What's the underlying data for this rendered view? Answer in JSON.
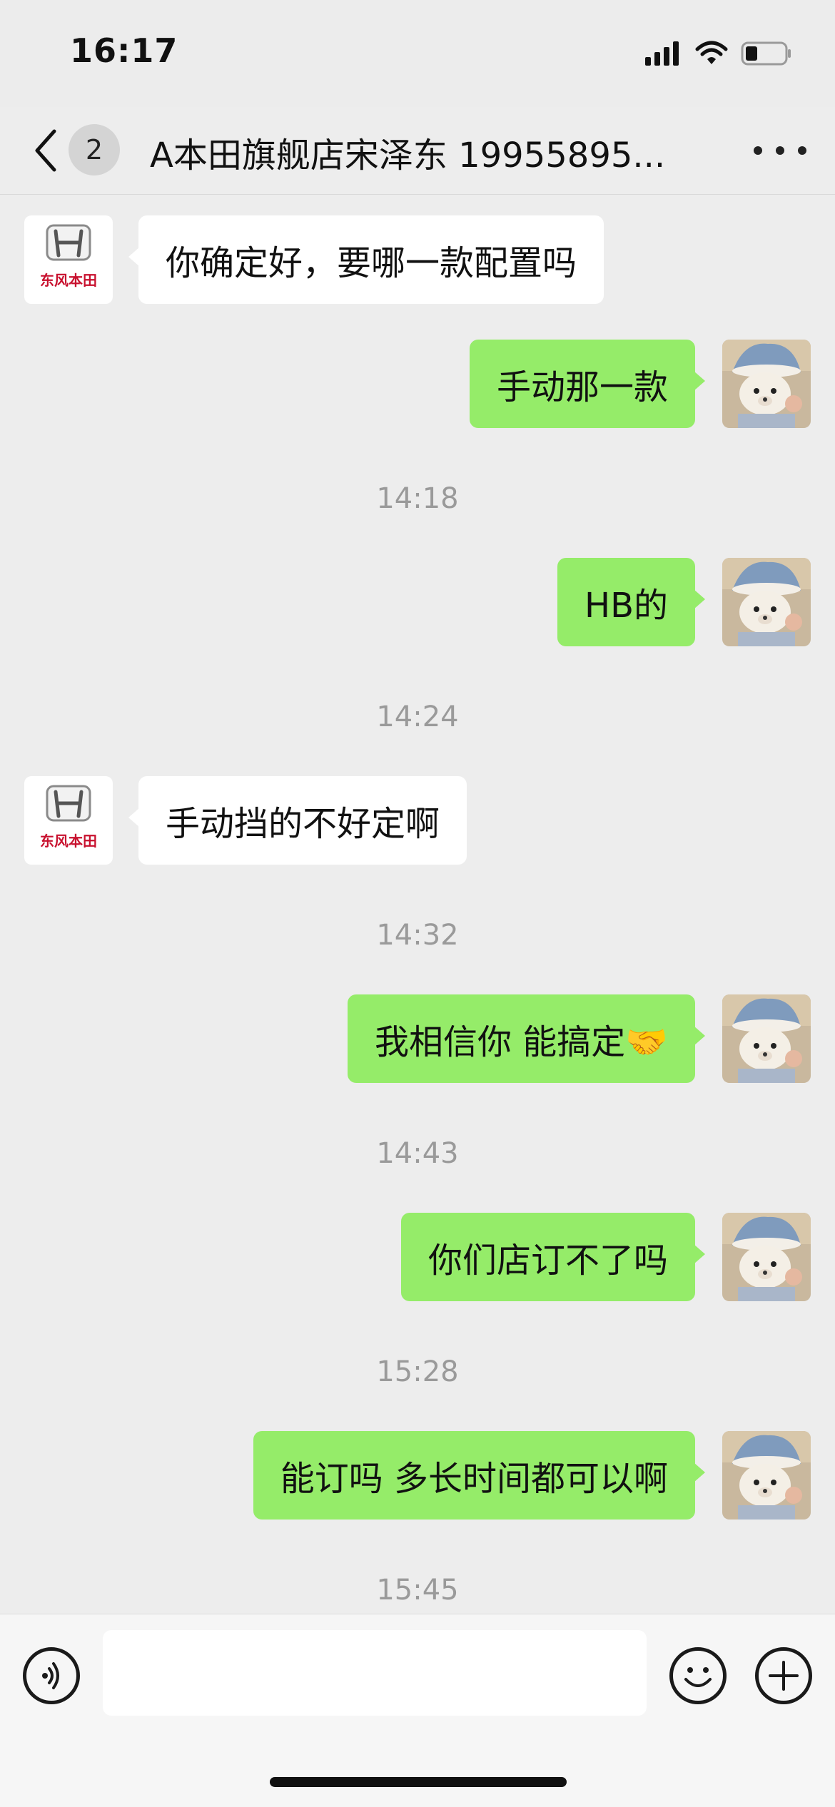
{
  "status_bar": {
    "time": "16:17"
  },
  "header": {
    "unread_count": "2",
    "title": "A本田旗舰店宋泽东 19955895..."
  },
  "contact_avatar": {
    "logo_text": "东风本田"
  },
  "messages": [
    {
      "side": "left",
      "text": "你确定好，要哪一款配置吗"
    },
    {
      "side": "right",
      "text": "手动那一款"
    },
    {
      "type": "time",
      "text": "14:18"
    },
    {
      "side": "right",
      "text": "HB的"
    },
    {
      "type": "time",
      "text": "14:24"
    },
    {
      "side": "left",
      "text": "手动挡的不好定啊"
    },
    {
      "type": "time",
      "text": "14:32"
    },
    {
      "side": "right",
      "text": "我相信你 能搞定🤝"
    },
    {
      "type": "time",
      "text": "14:43"
    },
    {
      "side": "right",
      "text": "你们店订不了吗"
    },
    {
      "type": "time",
      "text": "15:28"
    },
    {
      "side": "right",
      "text": "能订吗 多长时间都可以啊"
    },
    {
      "type": "time",
      "text": "15:45"
    }
  ],
  "input_bar": {
    "value": ""
  },
  "colors": {
    "sent_bubble": "#95ec69",
    "received_bubble": "#ffffff",
    "background": "#ededed",
    "brand_red": "#c8102e"
  }
}
